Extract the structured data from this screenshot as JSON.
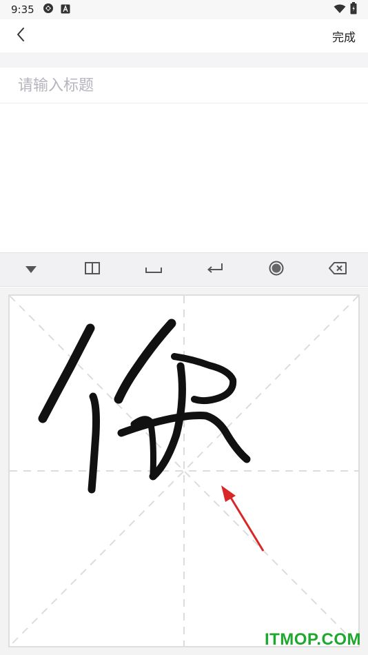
{
  "status_bar": {
    "time": "9:35",
    "icons_left": [
      "sync-icon",
      "app-a-icon"
    ],
    "icons_right": [
      "wifi-icon",
      "battery-icon"
    ]
  },
  "nav": {
    "back_icon": "chevron-left-icon",
    "done_label": "完成"
  },
  "title": {
    "placeholder": "请输入标题",
    "value": ""
  },
  "keyboard_toolbar": {
    "keys": [
      "collapse-keyboard-icon",
      "split-layout-icon",
      "space-icon",
      "enter-icon",
      "pen-icon",
      "backspace-icon"
    ]
  },
  "handwriting": {
    "recognized_char": "",
    "stroke_color": "#111111",
    "guide_color": "#dcdcdc"
  },
  "watermark": {
    "text": "ITMOP.COM",
    "color": "#1fa82f"
  },
  "colors": {
    "accent_arrow": "#d92626"
  }
}
